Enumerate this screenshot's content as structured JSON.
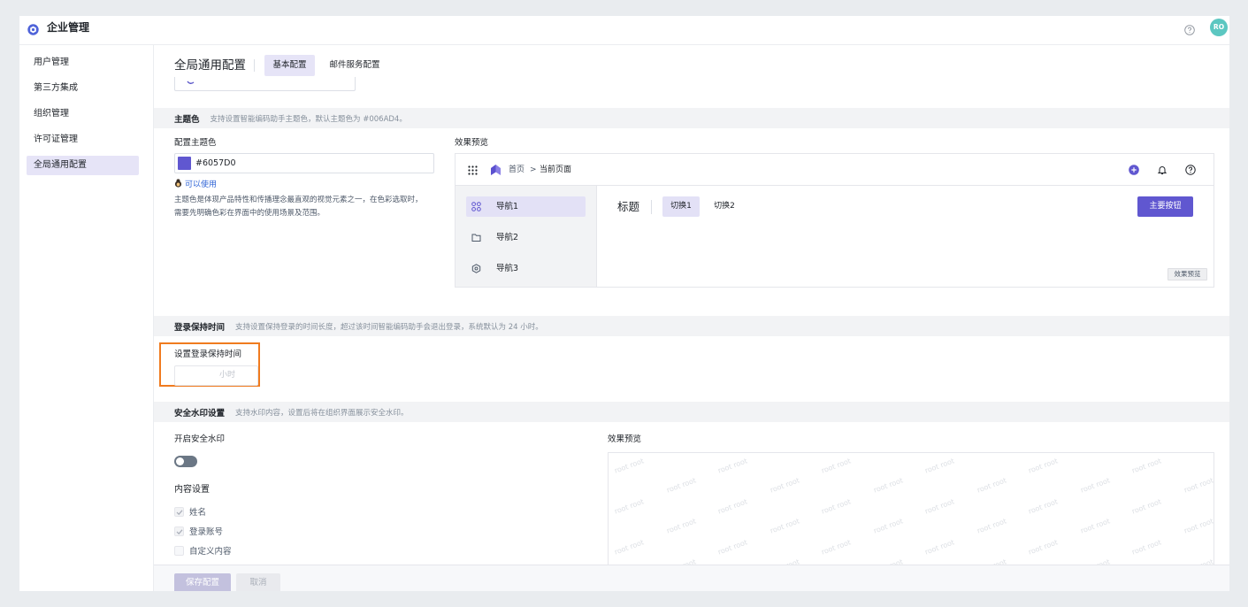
{
  "app": {
    "title": "企业管理",
    "avatar_initials": "RO",
    "logo_icon": "hex-logo-icon",
    "help_icon": "question-circle-icon"
  },
  "sidebar": {
    "items": [
      {
        "label": "用户管理",
        "active": false
      },
      {
        "label": "第三方集成",
        "active": false
      },
      {
        "label": "组织管理",
        "active": false
      },
      {
        "label": "许可证管理",
        "active": false
      },
      {
        "label": "全局通用配置",
        "active": true
      }
    ]
  },
  "header": {
    "title": "全局通用配置",
    "tabs": [
      {
        "label": "基本配置",
        "active": true
      },
      {
        "label": "邮件服务配置",
        "active": false
      }
    ]
  },
  "theme_section": {
    "title": "主题色",
    "description": "支持设置智能编码助手主题色，默认主题色为 #006AD4。",
    "field_label": "配置主题色",
    "color_value": "#6057D0",
    "hint": "可以使用",
    "help_lines": [
      "主题色是体现产品特性和传播理念最直观的视觉元素之一，在色彩选取时，",
      "需要先明确色彩在界面中的使用场景及范围。"
    ],
    "preview": {
      "label": "效果预览",
      "breadcrumb": {
        "home": "首页",
        "separator": ">",
        "current": "当前页面"
      },
      "nav": [
        {
          "label": "导航1",
          "icon": "apps-icon",
          "active": true
        },
        {
          "label": "导航2",
          "icon": "folder-icon",
          "active": false
        },
        {
          "label": "导航3",
          "icon": "hexagon-icon",
          "active": false
        }
      ],
      "content_title": "标题",
      "tabs": [
        {
          "label": "切换1",
          "active": true
        },
        {
          "label": "切换2",
          "active": false
        }
      ],
      "primary_button": "主要按钮",
      "tag": "效果预览"
    }
  },
  "login_section": {
    "title": "登录保持时间",
    "description": "支持设置保持登录的时间长度，超过该时间智能编码助手会退出登录，系统默认为 24 小时。",
    "field_label": "设置登录保持时间",
    "unit": "小时"
  },
  "watermark_section": {
    "title": "安全水印设置",
    "description": "支持水印内容，设置后将在组织界面展示安全水印。",
    "toggle_label": "开启安全水印",
    "enabled": false,
    "content_label": "内容设置",
    "options": [
      {
        "label": "姓名",
        "checked": true
      },
      {
        "label": "登录账号",
        "checked": true
      },
      {
        "label": "自定义内容",
        "checked": false
      }
    ],
    "preview_label": "效果预览",
    "watermark_text": "root root"
  },
  "footer": {
    "save_label": "保存配置",
    "cancel_label": "取消"
  },
  "colors": {
    "primary": "#6057D0",
    "highlight_border": "#F07B1F",
    "avatar": "#5CC7C1"
  }
}
